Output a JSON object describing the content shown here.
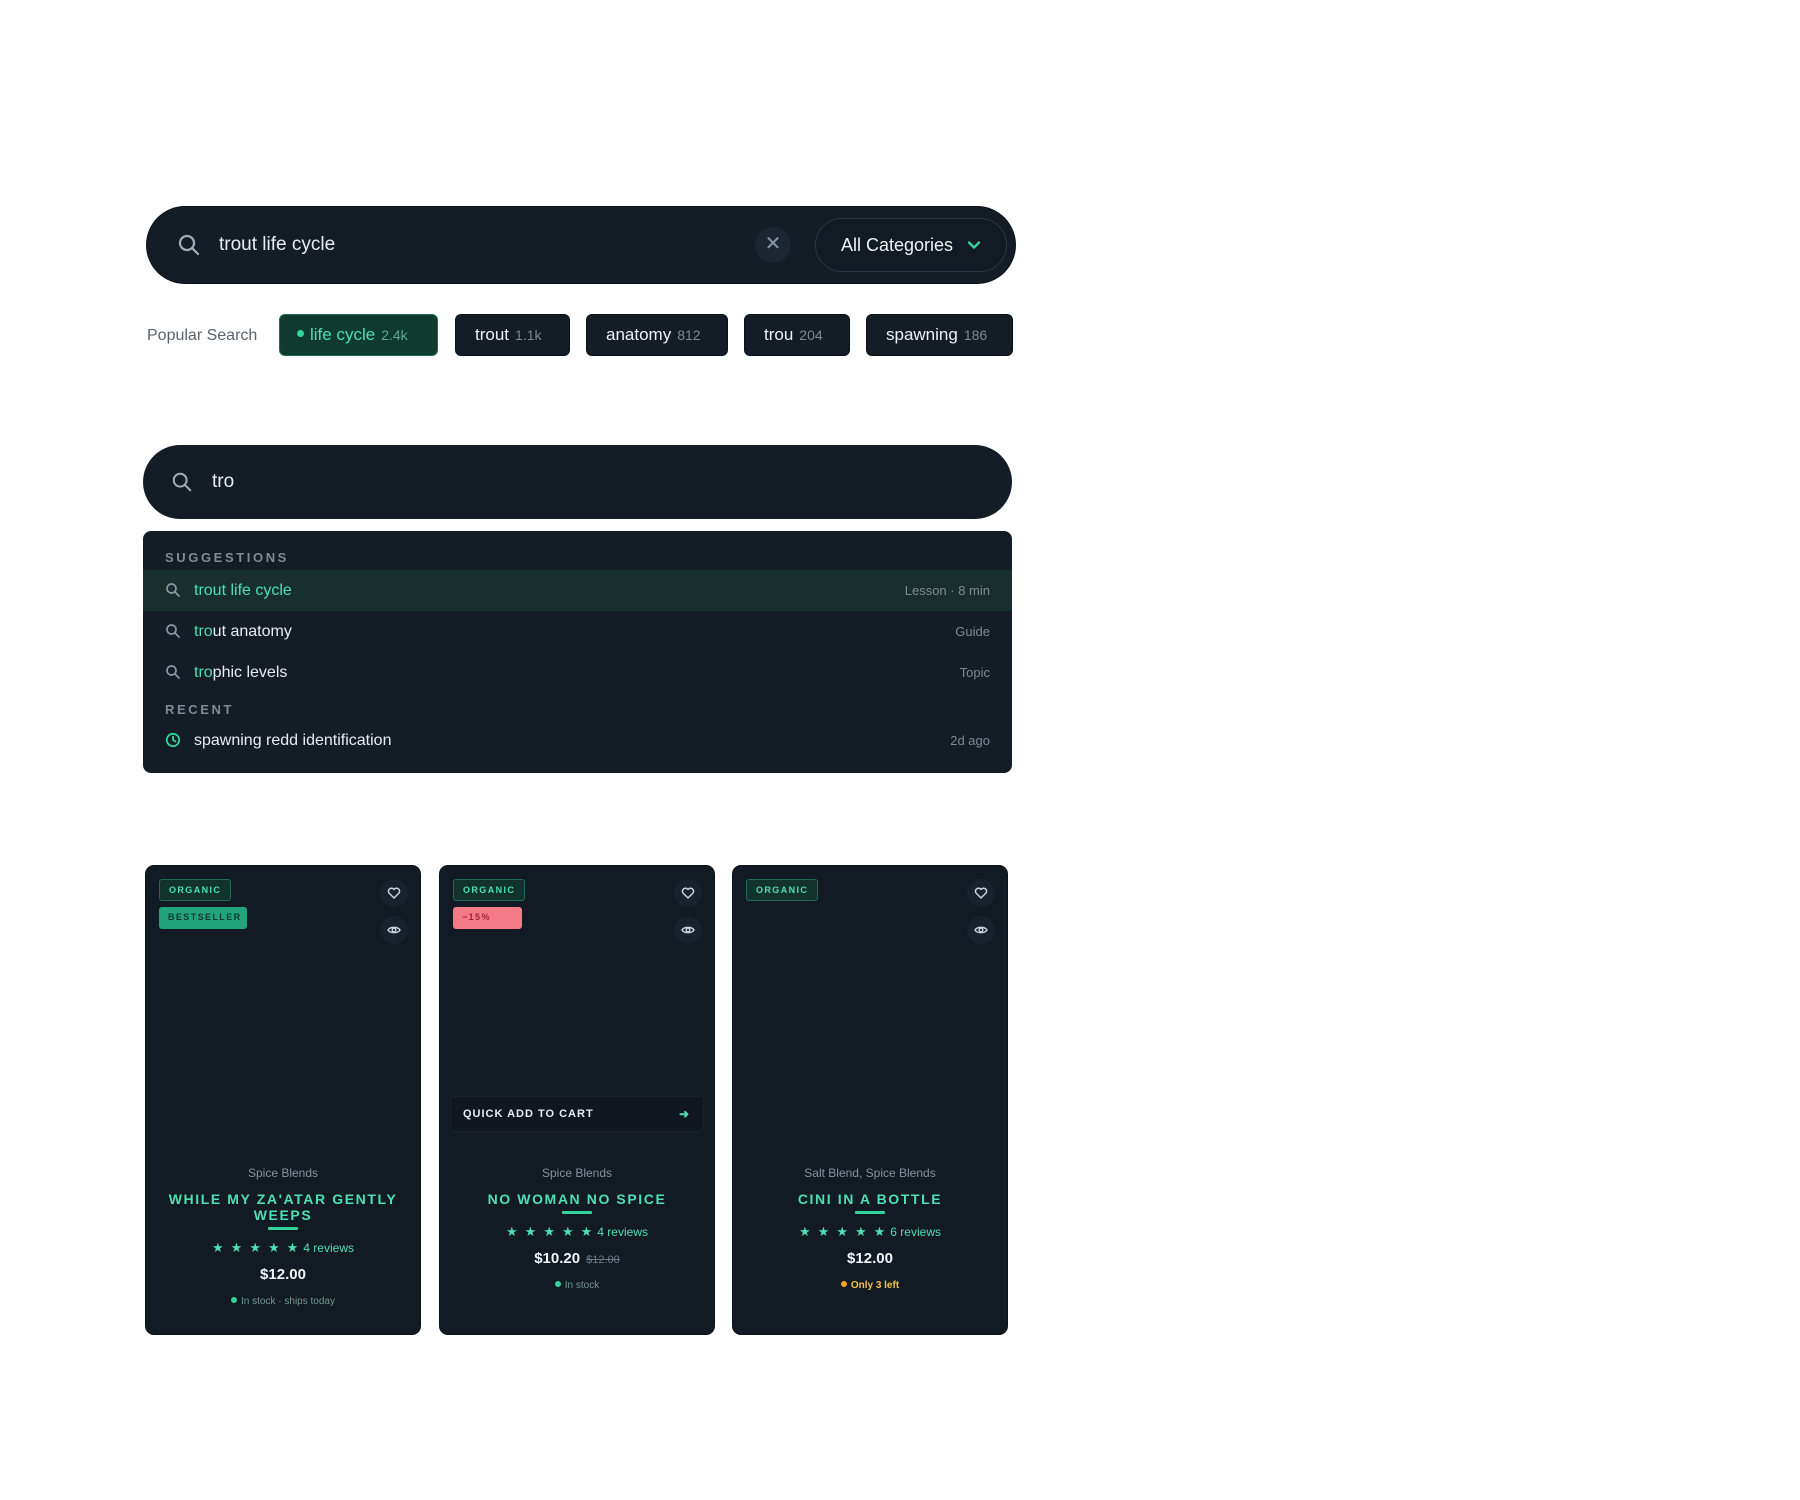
{
  "search_primary": {
    "query": "trout life cycle",
    "clear_label": "✕",
    "category": "All Categories"
  },
  "popular": {
    "label": "Popular Search",
    "chips": [
      {
        "label": "life cycle",
        "count": "2.4k",
        "active": true
      },
      {
        "label": "trout",
        "count": "1.1k"
      },
      {
        "label": "anatomy",
        "count": "812"
      },
      {
        "label": "trou",
        "count": "204"
      },
      {
        "label": "spawning",
        "count": "186"
      }
    ]
  },
  "search_secondary": {
    "query": "tro"
  },
  "dropdown": {
    "suggestions_heading": "SUGGESTIONS",
    "suggestions": [
      {
        "match": "tro",
        "rest": "ut life cycle",
        "meta": "Lesson · 8 min",
        "highlighted": true
      },
      {
        "match": "tro",
        "rest": "ut anatomy",
        "meta": "Guide"
      },
      {
        "match": "tro",
        "rest": "phic levels",
        "meta": "Topic"
      }
    ],
    "recent_heading": "RECENT",
    "recent": [
      {
        "label": "spawning redd identification",
        "meta": "2d ago"
      }
    ]
  },
  "products": [
    {
      "badges": [
        "ORGANIC",
        "BESTSELLER"
      ],
      "category": "Spice Blends",
      "title": "WHILE MY ZA'ATAR GENTLY WEEPS",
      "rating": 5,
      "reviews": "4 reviews",
      "price": "$12.00",
      "stock": "In stock · ships today"
    },
    {
      "badges": [
        "ORGANIC",
        "−15%"
      ],
      "quick_add": "QUICK ADD TO CART",
      "category": "Spice Blends",
      "title": "NO WOMAN NO SPICE",
      "rating": 5,
      "reviews": "4 reviews",
      "price": "$10.20",
      "old_price": "$12.00",
      "stock": "In stock"
    },
    {
      "badges": [
        "ORGANIC"
      ],
      "category": "Salt Blend, Spice Blends",
      "title": "CINI IN A BOTTLE",
      "rating": 5,
      "reviews": "6 reviews",
      "price": "$12.00",
      "stock": "Only 3 left"
    }
  ],
  "colors": {
    "accent": "#4ee0b0",
    "surface": "#141c26",
    "warning": "#f5a524",
    "discount": "#f47a87"
  },
  "icons": {
    "search": "search-icon",
    "clear": "close-icon",
    "dropdown": "chevron-down-icon",
    "recent": "clock-icon",
    "wishlist": "heart-icon",
    "quick_view": "eye-icon",
    "go": "arrow-right-icon"
  }
}
